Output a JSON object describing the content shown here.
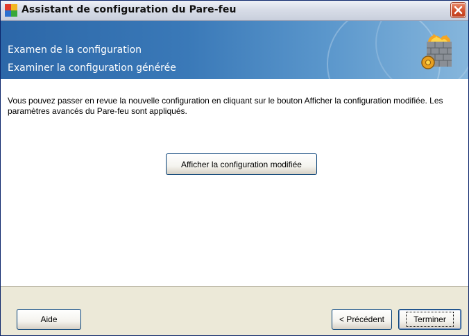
{
  "window": {
    "title": "Assistant de configuration du Pare-feu",
    "icons": {
      "app": "avg-app-icon",
      "close": "close-icon"
    }
  },
  "banner": {
    "heading": "Examen de la configuration",
    "subheading": "Examiner la configuration générée",
    "icon": "firewall-icon"
  },
  "content": {
    "description": "Vous pouvez passer en revue la nouvelle configuration en cliquant sur le bouton Afficher la configuration modifiée. Les paramètres avancés du Pare-feu sont appliqués.",
    "show_config_button": "Afficher la configuration modifiée"
  },
  "footer": {
    "help_button": "Aide",
    "previous_button": "< Précédent",
    "finish_button": "Terminer"
  },
  "colors": {
    "banner_start": "#2c67a8",
    "banner_end": "#86b6dc",
    "close_button": "#d2512d",
    "dialog_background": "#ece9d8"
  }
}
